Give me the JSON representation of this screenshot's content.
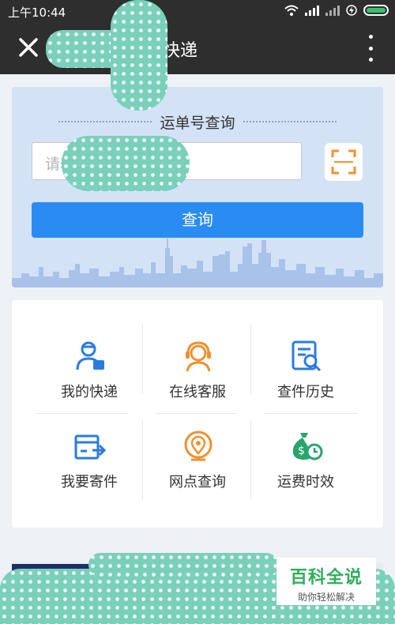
{
  "status_bar": {
    "time": "上午10:44"
  },
  "toolbar": {
    "title": "快递"
  },
  "query": {
    "section_title": "运单号查询",
    "input_placeholder": "请输入运单号",
    "submit_label": "查询"
  },
  "services": [
    {
      "label": "我的快递",
      "icon": "courier-person-icon"
    },
    {
      "label": "在线客服",
      "icon": "headset-agent-icon"
    },
    {
      "label": "查件历史",
      "icon": "history-search-icon"
    },
    {
      "label": "我要寄件",
      "icon": "send-package-icon"
    },
    {
      "label": "网点查询",
      "icon": "location-pin-icon"
    },
    {
      "label": "运费时效",
      "icon": "money-clock-icon"
    }
  ],
  "watermark": {
    "title": "百科全说",
    "subtitle": "助你轻松解决"
  },
  "colors": {
    "primary": "#2a8cf3",
    "toolbar": "#2e2e2e",
    "icon_blue": "#2a7be0",
    "icon_orange": "#f0912f",
    "icon_green": "#27a56a",
    "query_bg": "#d4e2f6"
  }
}
